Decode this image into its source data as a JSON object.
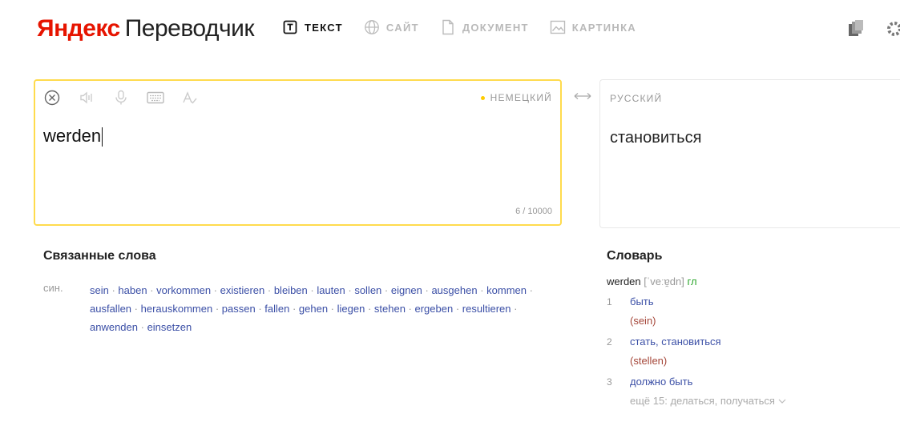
{
  "header": {
    "logo_brand": "Яндекс",
    "logo_product": "Переводчик",
    "tabs": [
      {
        "label": "ТЕКСТ",
        "icon": "text-icon",
        "active": true
      },
      {
        "label": "САЙТ",
        "icon": "globe-icon",
        "active": false
      },
      {
        "label": "ДОКУМЕНТ",
        "icon": "document-icon",
        "active": false
      },
      {
        "label": "КАРТИНКА",
        "icon": "image-icon",
        "active": false
      }
    ]
  },
  "source": {
    "language": "НЕМЕЦКИЙ",
    "text": "werden",
    "counter": "6 / 10000"
  },
  "target": {
    "language": "РУССКИЙ",
    "text": "становиться"
  },
  "related": {
    "title": "Связанные слова",
    "label": "син.",
    "words": [
      "sein",
      "haben",
      "vorkommen",
      "existieren",
      "bleiben",
      "lauten",
      "sollen",
      "eignen",
      "ausgehen",
      "kommen",
      "ausfallen",
      "herauskommen",
      "passen",
      "fallen",
      "gehen",
      "liegen",
      "stehen",
      "ergeben",
      "resultieren",
      "anwenden",
      "einsetzen"
    ]
  },
  "dictionary": {
    "title": "Словарь",
    "word": "werden",
    "transcription": "[ˈveːɐ̯dn]",
    "pos": "гл",
    "entries": [
      {
        "num": "1",
        "meaning": "быть",
        "example": "(sein)"
      },
      {
        "num": "2",
        "meaning": "стать, становиться",
        "example": "(stellen)"
      },
      {
        "num": "3",
        "meaning": "должно быть",
        "example": ""
      }
    ],
    "more": "ещё 15: делаться, получаться"
  },
  "colors": {
    "brand_red": "#e61400",
    "active_border": "#ffdb4d",
    "link_blue": "#3b4fa6",
    "pos_green": "#2aa52a",
    "example_red": "#a5473a"
  }
}
